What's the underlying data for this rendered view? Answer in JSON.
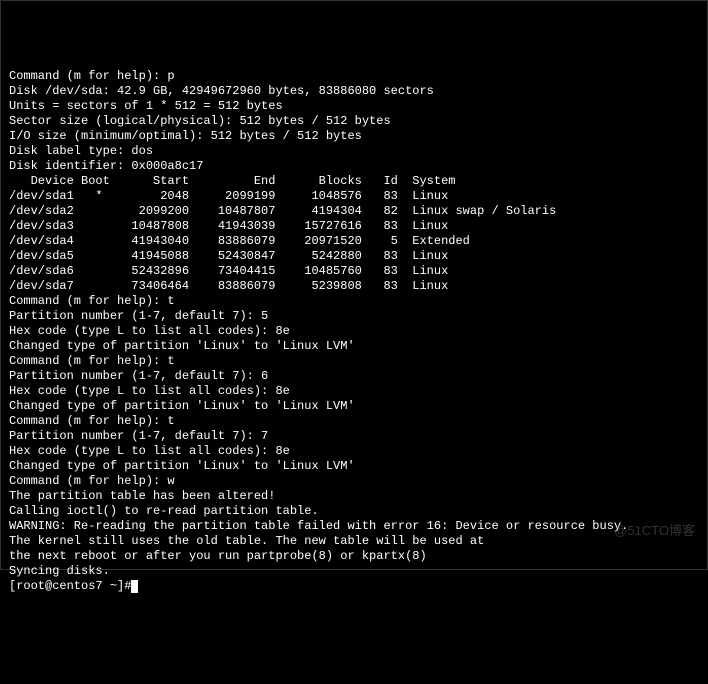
{
  "cmd1_prompt": "Command (m for help): ",
  "cmd1_input": "p",
  "blank": "",
  "disk_info": [
    "Disk /dev/sda: 42.9 GB, 42949672960 bytes, 83886080 sectors",
    "Units = sectors of 1 * 512 = 512 bytes",
    "Sector size (logical/physical): 512 bytes / 512 bytes",
    "I/O size (minimum/optimal): 512 bytes / 512 bytes",
    "Disk label type: dos",
    "Disk identifier: 0x000a8c17"
  ],
  "table_header": "   Device Boot      Start         End      Blocks   Id  System",
  "table_rows": [
    "/dev/sda1   *        2048     2099199     1048576   83  Linux",
    "/dev/sda2         2099200    10487807     4194304   82  Linux swap / Solaris",
    "/dev/sda3        10487808    41943039    15727616   83  Linux",
    "/dev/sda4        41943040    83886079    20971520    5  Extended",
    "/dev/sda5        41945088    52430847     5242880   83  Linux",
    "/dev/sda6        52432896    73404415    10485760   83  Linux",
    "/dev/sda7        73406464    83886079     5239808   83  Linux"
  ],
  "seq": [
    {
      "prompt": "Command (m for help): ",
      "input": "t"
    },
    {
      "prompt": "Partition number (1-7, default 7): ",
      "input": "5"
    },
    {
      "prompt": "Hex code (type L to list all codes): ",
      "input": "8e"
    },
    {
      "msg": "Changed type of partition 'Linux' to 'Linux LVM'"
    },
    {
      "blank": true
    },
    {
      "prompt": "Command (m for help): ",
      "input": "t"
    },
    {
      "prompt": "Partition number (1-7, default 7): ",
      "input": "6"
    },
    {
      "prompt": "Hex code (type L to list all codes): ",
      "input": "8e"
    },
    {
      "msg": "Changed type of partition 'Linux' to 'Linux LVM'"
    },
    {
      "blank": true
    },
    {
      "prompt": "Command (m for help): ",
      "input": "t"
    },
    {
      "prompt": "Partition number (1-7, default 7): ",
      "input": "7"
    },
    {
      "prompt": "Hex code (type L to list all codes): ",
      "input": "8e"
    },
    {
      "msg": "Changed type of partition 'Linux' to 'Linux LVM'"
    },
    {
      "blank": true
    },
    {
      "prompt": "Command (m for help): ",
      "input": "w"
    },
    {
      "msg": "The partition table has been altered!"
    },
    {
      "blank": true
    },
    {
      "msg": "Calling ioctl() to re-read partition table."
    },
    {
      "blank": true
    },
    {
      "msg": "WARNING: Re-reading the partition table failed with error 16: Device or resource busy."
    },
    {
      "msg": "The kernel still uses the old table. The new table will be used at"
    },
    {
      "msg": "the next reboot or after you run partprobe(8) or kpartx(8)"
    },
    {
      "msg": "Syncing disks."
    }
  ],
  "shell_prompt": "[root@centos7 ~]#",
  "watermark": "@51CTO博客"
}
